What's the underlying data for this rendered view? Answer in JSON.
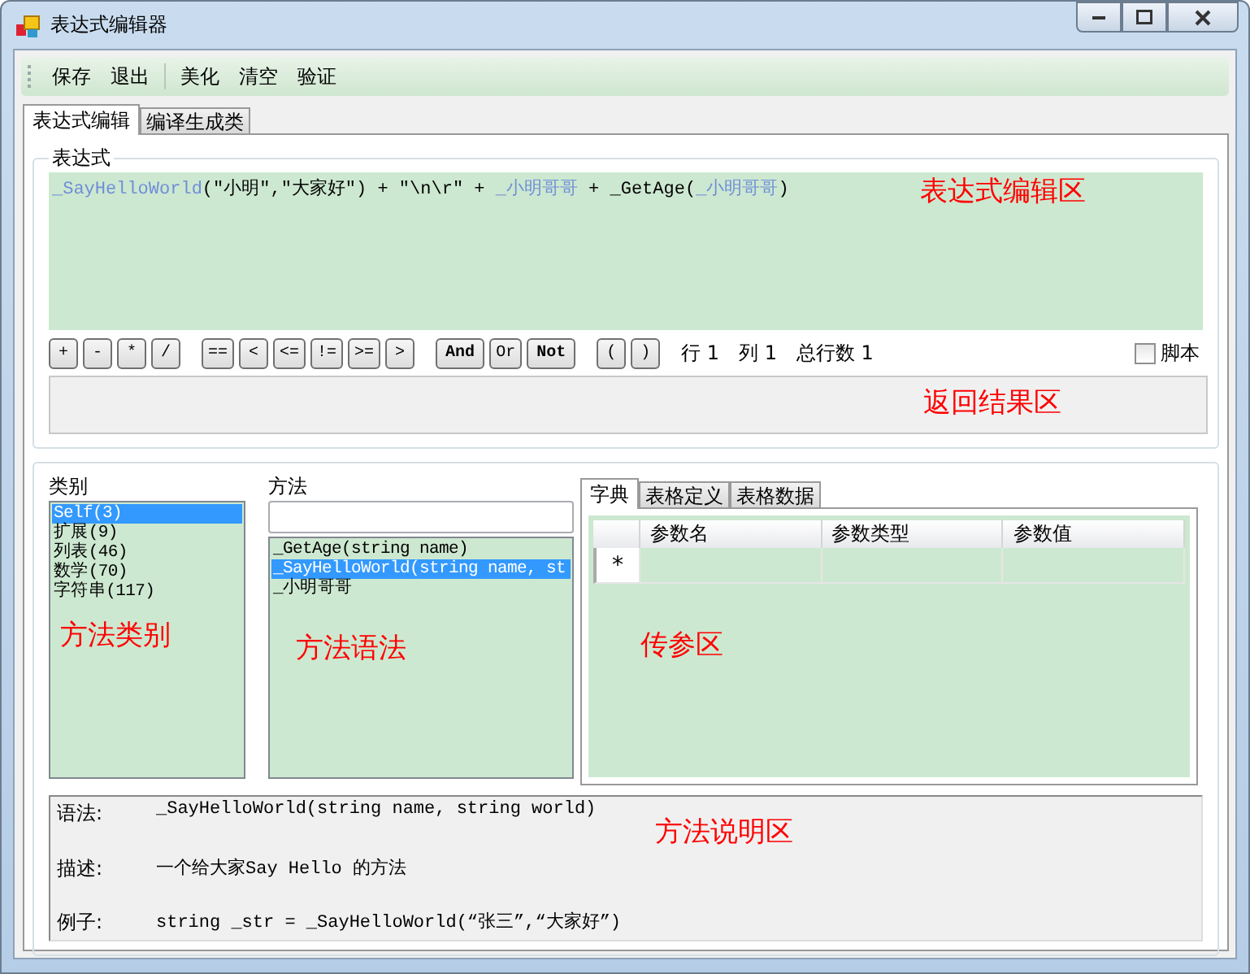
{
  "window": {
    "title": "表达式编辑器"
  },
  "toolbar": {
    "groups": [
      [
        "保存",
        "退出"
      ],
      [
        "美化",
        "清空",
        "验证"
      ]
    ]
  },
  "tabs": [
    {
      "label": "表达式编辑",
      "selected": true
    },
    {
      "label": "编译生成类",
      "selected": false
    }
  ],
  "expression_group": {
    "title": "表达式",
    "tokens": [
      {
        "text": "_SayHelloWorld",
        "kind": "identifier"
      },
      {
        "text": "(\"小明\",\"大家好\") + \"\\n\\r\" + ",
        "kind": "plain"
      },
      {
        "text": "_小明哥哥",
        "kind": "identifier"
      },
      {
        "text": " + _GetAge(",
        "kind": "plain"
      },
      {
        "text": "_小明哥哥",
        "kind": "identifier"
      },
      {
        "text": ")",
        "kind": "plain"
      }
    ],
    "editor_note": "表达式编辑区",
    "operator_groups": [
      [
        "+",
        "-",
        "*",
        "/"
      ],
      [
        "==",
        "<",
        "<=",
        "!=",
        ">=",
        ">"
      ],
      [
        "And",
        "Or",
        "Not"
      ],
      [
        "(",
        ")"
      ]
    ],
    "position": [
      "行 1",
      "列 1",
      "总行数 1"
    ],
    "script_checkbox": {
      "label": "脚本",
      "checked": false
    },
    "result_note": "返回结果区"
  },
  "categories": {
    "label": "类别",
    "items": [
      {
        "text": "Self(3)",
        "selected": true
      },
      {
        "text": "扩展(9)",
        "selected": false
      },
      {
        "text": "列表(46)",
        "selected": false
      },
      {
        "text": "数学(70)",
        "selected": false
      },
      {
        "text": "字符串(117)",
        "selected": false
      }
    ],
    "note": "方法类别"
  },
  "methods": {
    "label": "方法",
    "items": [
      {
        "text": "_GetAge(string name)",
        "selected": false
      },
      {
        "text": "_SayHelloWorld(string name, st",
        "selected": true
      },
      {
        "text": "_小明哥哥",
        "selected": false
      }
    ],
    "note": "方法语法"
  },
  "param_tabs": [
    {
      "label": "字典",
      "selected": true
    },
    {
      "label": "表格定义",
      "selected": false
    },
    {
      "label": "表格数据",
      "selected": false
    }
  ],
  "param_grid": {
    "columns": [
      "参数名",
      "参数类型",
      "参数值"
    ],
    "new_row_marker": "*",
    "note": "传参区"
  },
  "description": {
    "rows": [
      {
        "label": "语法:",
        "value": "_SayHelloWorld(string name, string world)"
      },
      {
        "label": "描述:",
        "value": "一个给大家Say Hello 的方法"
      },
      {
        "label": "例子:",
        "value": "string _str = _SayHelloWorld(“张三”,“大家好”)"
      }
    ],
    "note": "方法说明区"
  }
}
